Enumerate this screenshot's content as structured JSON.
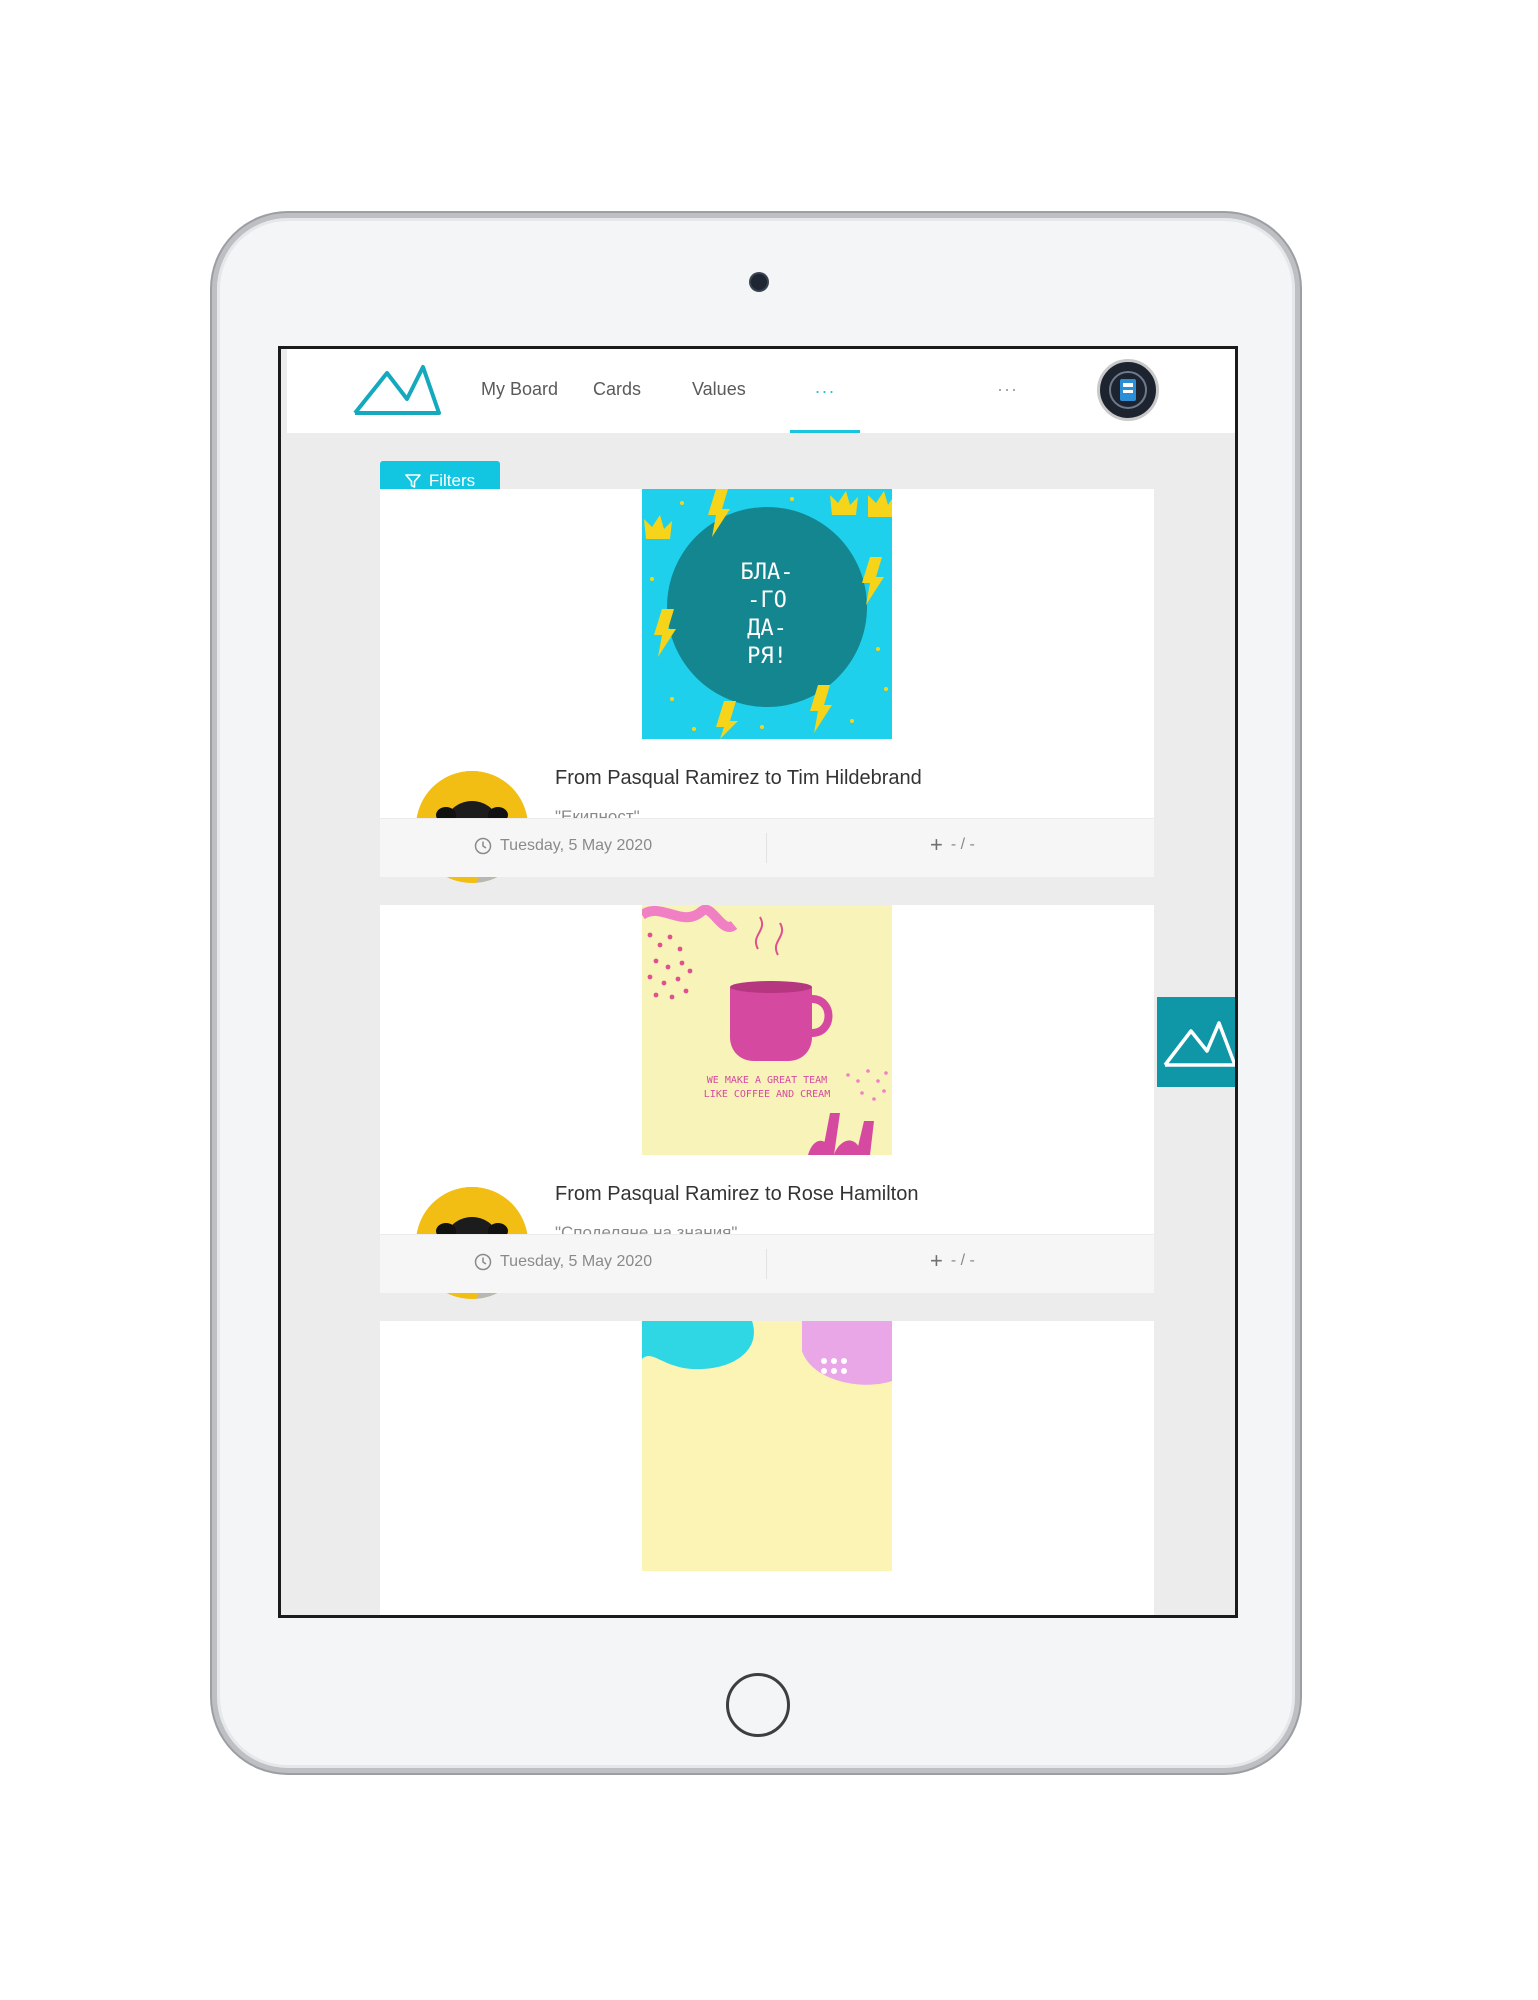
{
  "nav": {
    "items": [
      {
        "label": "My Board"
      },
      {
        "label": "Cards"
      },
      {
        "label": "Values"
      }
    ],
    "more_active": "···",
    "more": "···"
  },
  "filters": {
    "label": "Filters"
  },
  "cards": [
    {
      "title": "From Pasqual Ramirez to Tim Hildebrand",
      "value": "\"Екипност\"",
      "date": "Tuesday, 5 May 2020",
      "votes": "- / -",
      "image_text": [
        "БЛА-",
        "-ГО",
        "ДА-",
        "РЯ!"
      ]
    },
    {
      "title": "From Pasqual Ramirez to Rose Hamilton",
      "value": "\"Споделяне на знания\"",
      "date": "Tuesday, 5 May 2020",
      "votes": "- / -",
      "image_text": [
        "WE MAKE A GREAT TEAM",
        "LIKE COFFEE AND CREAM"
      ]
    }
  ],
  "colors": {
    "accent": "#12c6e2",
    "brand_teal": "#0f97a7",
    "pug_bg": "#f2be14"
  }
}
